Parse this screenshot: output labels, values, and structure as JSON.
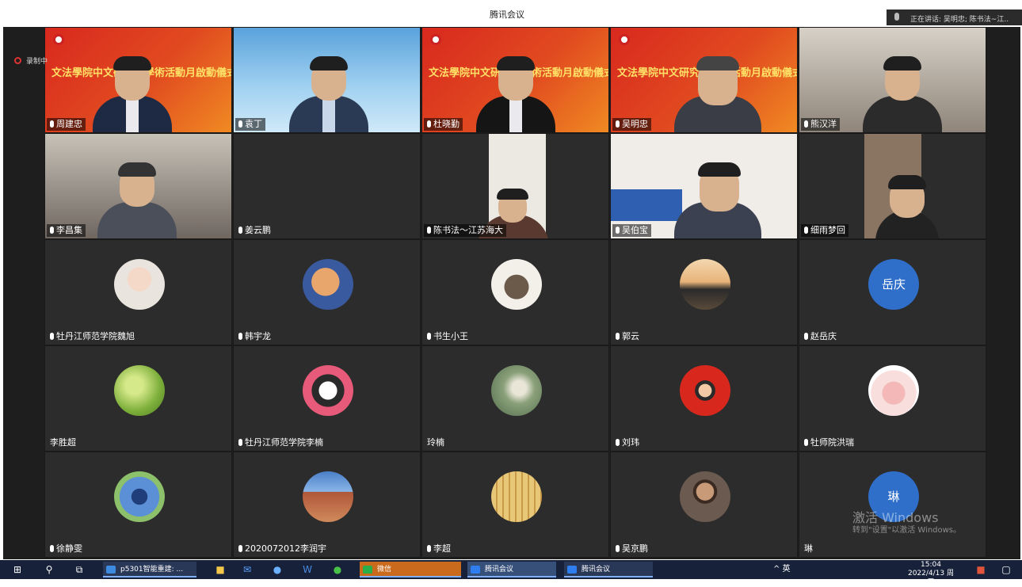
{
  "window": {
    "title": "腾讯会议",
    "speaking_label": "正在讲话: 吴明忠; 陈书法~江..",
    "recording_label": "录制中"
  },
  "banner_text": "文法學院中文研究生學術活動月啟動儀式",
  "participants": [
    {
      "name": "周建忠",
      "kind": "video"
    },
    {
      "name": "袁丁",
      "kind": "video"
    },
    {
      "name": "杜晓勤",
      "kind": "video"
    },
    {
      "name": "吴明忠",
      "kind": "video"
    },
    {
      "name": "熊汉洋",
      "kind": "video"
    },
    {
      "name": "李昌集",
      "kind": "video"
    },
    {
      "name": "姜云鹏",
      "kind": "off"
    },
    {
      "name": "陈书法～江苏海大",
      "kind": "video"
    },
    {
      "name": "吴伯宝",
      "kind": "video"
    },
    {
      "name": "细雨梦回",
      "kind": "video"
    },
    {
      "name": "牡丹江师范学院魏旭",
      "kind": "avatar",
      "avatar_icon": "girl-photo-avatar"
    },
    {
      "name": "韩宇龙",
      "kind": "avatar",
      "avatar_icon": "anime-boy-avatar"
    },
    {
      "name": "书生小王",
      "kind": "avatar",
      "avatar_icon": "cat-photo-avatar"
    },
    {
      "name": "郭云",
      "kind": "avatar",
      "avatar_icon": "sunset-lake-avatar"
    },
    {
      "name": "赵岳庆",
      "kind": "avatar",
      "avatar_text": "岳庆"
    },
    {
      "name": "李胜超",
      "kind": "avatar",
      "avatar_icon": "green-meadow-avatar"
    },
    {
      "name": "牡丹江师范学院李楠",
      "kind": "avatar",
      "avatar_icon": "kuromi-avatar"
    },
    {
      "name": "玲楠",
      "kind": "avatar",
      "avatar_icon": "floral-painting-avatar"
    },
    {
      "name": "刘玮",
      "kind": "avatar",
      "avatar_icon": "cartoon-girl-avatar"
    },
    {
      "name": "牡师院洪瑞",
      "kind": "avatar",
      "avatar_icon": "pig-avatar"
    },
    {
      "name": "徐静雯",
      "kind": "avatar",
      "avatar_icon": "stitch-avatar"
    },
    {
      "name": "2020072012李润宇",
      "kind": "avatar",
      "avatar_icon": "castle-avatar"
    },
    {
      "name": "李超",
      "kind": "avatar",
      "avatar_icon": "calligraphy-avatar"
    },
    {
      "name": "吴京鹏",
      "kind": "avatar",
      "avatar_icon": "man-photo-avatar"
    },
    {
      "name": "琳",
      "kind": "avatar",
      "avatar_text": "琳"
    }
  ],
  "watermark": {
    "line1": "激活 Windows",
    "line2": "转到\"设置\"以激活 Windows。"
  },
  "taskbar": {
    "tasks": [
      {
        "label": "p5301智能重建: ...",
        "icon": "edge-browser-icon"
      },
      {
        "label": "微信",
        "icon": "wechat-icon"
      },
      {
        "label": "腾讯会议",
        "icon": "tencent-meeting-icon"
      },
      {
        "label": "腾讯会议",
        "icon": "tencent-meeting-icon"
      }
    ],
    "tray_text": "^ 英",
    "time": "15:04",
    "date": "2022/4/13 周三"
  },
  "colors": {
    "stage": "#1e1e1e",
    "tile": "#2c2c2c",
    "taskbar": "#17223a",
    "banner_red": "#d8281e",
    "avatar_blue": "#2f6fca"
  }
}
